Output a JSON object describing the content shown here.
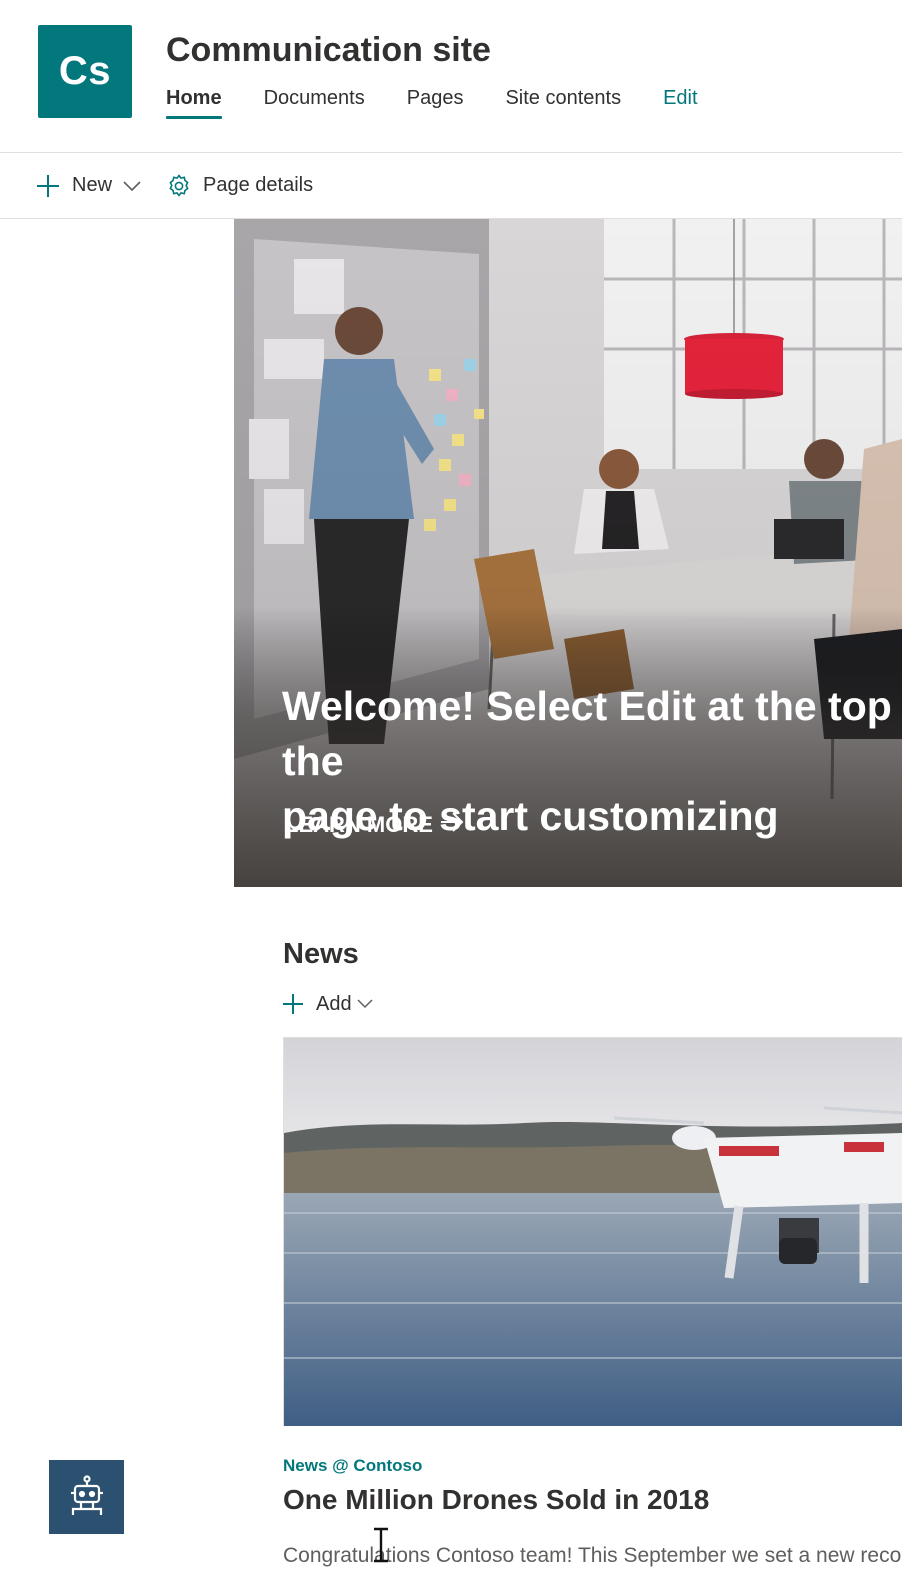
{
  "site": {
    "logo_initials": "Cs",
    "title": "Communication site",
    "brand_color": "#03787c"
  },
  "nav": {
    "items": [
      {
        "label": "Home",
        "active": true
      },
      {
        "label": "Documents"
      },
      {
        "label": "Pages"
      },
      {
        "label": "Site contents"
      },
      {
        "label": "Edit"
      }
    ]
  },
  "commandbar": {
    "new_label": "New",
    "page_details_label": "Page details",
    "icons": [
      "plus-icon",
      "chevron-down-icon",
      "gear-icon"
    ]
  },
  "hero": {
    "title": "Welcome! Select Edit at the top of the\npage to start customizing",
    "link_label": "LEARN MORE",
    "link_icon": "arrow-right-icon"
  },
  "news": {
    "heading": "News",
    "add_label": "Add",
    "card": {
      "source": "News @ Contoso",
      "title": "One Million Drones Sold in 2018",
      "description": "Congratulations Contoso team! This September we set a new record"
    }
  },
  "bot": {
    "icon": "robot-icon",
    "background": "#2c5170"
  }
}
